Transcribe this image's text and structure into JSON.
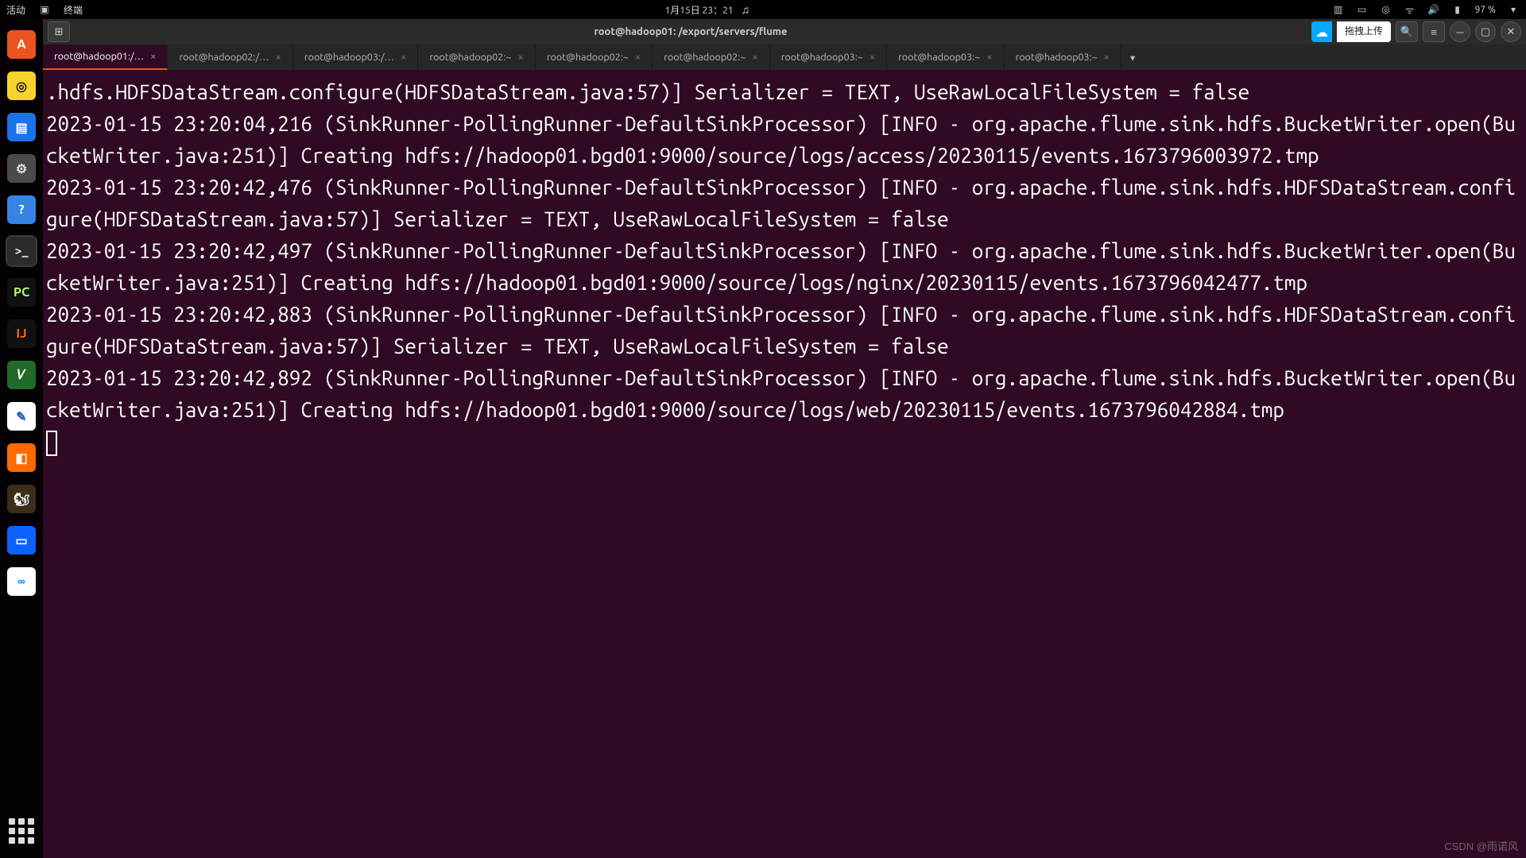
{
  "panel": {
    "activities": "活动",
    "app_menu": "终端",
    "clock": "1月15日  23：21",
    "battery": "97 %"
  },
  "dock": {
    "apps": [
      {
        "name": "ubuntu-software",
        "glyph": "A",
        "bg": "#e95420",
        "fg": "#fff"
      },
      {
        "name": "rhythmbox",
        "glyph": "◎",
        "bg": "#f6d32d",
        "fg": "#222"
      },
      {
        "name": "libreoffice-writer",
        "glyph": "▤",
        "bg": "#1a73e8",
        "fg": "#fff"
      },
      {
        "name": "settings",
        "glyph": "⚙",
        "bg": "#4a4a4a",
        "fg": "#ddd"
      },
      {
        "name": "help",
        "glyph": "?",
        "bg": "#3584e4",
        "fg": "#fff"
      },
      {
        "name": "terminal",
        "glyph": ">_",
        "bg": "#2b2b2b",
        "fg": "#ddd",
        "selected": true
      },
      {
        "name": "pycharm",
        "glyph": "PC",
        "bg": "#111",
        "fg": "#a9ff68"
      },
      {
        "name": "intellij",
        "glyph": "IJ",
        "bg": "#111",
        "fg": "#ff6a00"
      },
      {
        "name": "gvim",
        "glyph": "𝑉",
        "bg": "#206b2a",
        "fg": "#fff"
      },
      {
        "name": "text-editor",
        "glyph": "✎",
        "bg": "#ffffff",
        "fg": "#2257c7"
      },
      {
        "name": "virtualbox",
        "glyph": "◧",
        "bg": "#ff6a00",
        "fg": "#fff"
      },
      {
        "name": "dbeaver",
        "glyph": "🐿",
        "bg": "#3a2d1a",
        "fg": "#fff"
      },
      {
        "name": "meet",
        "glyph": "▭",
        "bg": "#0b63ff",
        "fg": "#fff"
      },
      {
        "name": "baidu-netdisk",
        "glyph": "∞",
        "bg": "#ffffff",
        "fg": "#06a7ff"
      }
    ]
  },
  "terminal": {
    "title": "root@hadoop01: /export/servers/flume",
    "promo_text": "拖拽上传",
    "tabs": [
      {
        "label": "root@hadoop01:/…",
        "active": true
      },
      {
        "label": "root@hadoop02:/…",
        "active": false
      },
      {
        "label": "root@hadoop03:/…",
        "active": false
      },
      {
        "label": "root@hadoop02:~",
        "active": false
      },
      {
        "label": "root@hadoop02:~",
        "active": false
      },
      {
        "label": "root@hadoop02:~",
        "active": false
      },
      {
        "label": "root@hadoop03:~",
        "active": false
      },
      {
        "label": "root@hadoop03:~",
        "active": false
      },
      {
        "label": "root@hadoop03:~",
        "active": false
      }
    ],
    "lines": [
      ".hdfs.HDFSDataStream.configure(HDFSDataStream.java:57)] Serializer = TEXT, UseRawLocalFileSystem = false",
      "2023-01-15 23:20:04,216 (SinkRunner-PollingRunner-DefaultSinkProcessor) [INFO - org.apache.flume.sink.hdfs.BucketWriter.open(BucketWriter.java:251)] Creating hdfs://hadoop01.bgd01:9000/source/logs/access/20230115/events.1673796003972.tmp",
      "2023-01-15 23:20:42,476 (SinkRunner-PollingRunner-DefaultSinkProcessor) [INFO - org.apache.flume.sink.hdfs.HDFSDataStream.configure(HDFSDataStream.java:57)] Serializer = TEXT, UseRawLocalFileSystem = false",
      "2023-01-15 23:20:42,497 (SinkRunner-PollingRunner-DefaultSinkProcessor) [INFO - org.apache.flume.sink.hdfs.BucketWriter.open(BucketWriter.java:251)] Creating hdfs://hadoop01.bgd01:9000/source/logs/nginx/20230115/events.1673796042477.tmp",
      "2023-01-15 23:20:42,883 (SinkRunner-PollingRunner-DefaultSinkProcessor) [INFO - org.apache.flume.sink.hdfs.HDFSDataStream.configure(HDFSDataStream.java:57)] Serializer = TEXT, UseRawLocalFileSystem = false",
      "2023-01-15 23:20:42,892 (SinkRunner-PollingRunner-DefaultSinkProcessor) [INFO - org.apache.flume.sink.hdfs.BucketWriter.open(BucketWriter.java:251)] Creating hdfs://hadoop01.bgd01:9000/source/logs/web/20230115/events.1673796042884.tmp"
    ]
  },
  "watermark": "CSDN @雨诺风"
}
